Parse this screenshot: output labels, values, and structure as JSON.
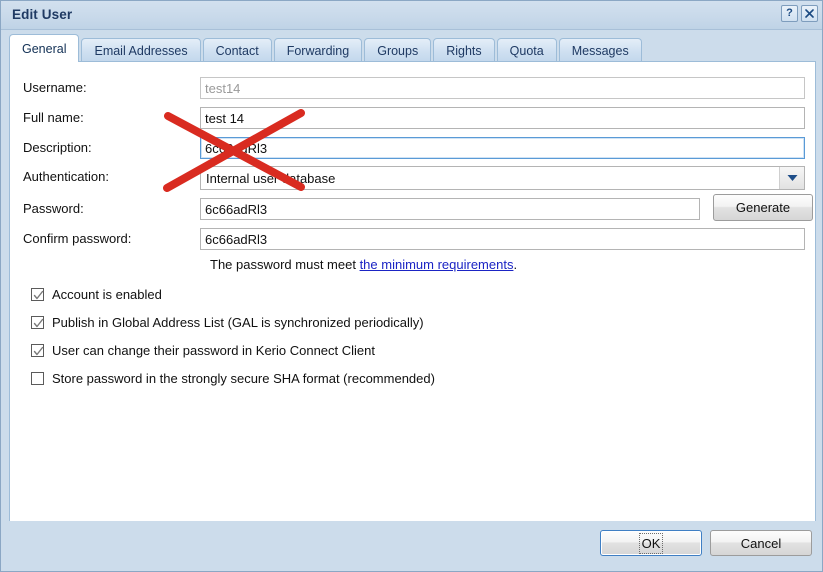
{
  "window": {
    "title": "Edit User",
    "help_button": "?",
    "close_button": "✕"
  },
  "tabs": [
    {
      "label": "General",
      "active": true
    },
    {
      "label": "Email Addresses",
      "active": false
    },
    {
      "label": "Contact",
      "active": false
    },
    {
      "label": "Forwarding",
      "active": false
    },
    {
      "label": "Groups",
      "active": false
    },
    {
      "label": "Rights",
      "active": false
    },
    {
      "label": "Quota",
      "active": false
    },
    {
      "label": "Messages",
      "active": false
    }
  ],
  "form": {
    "username": {
      "label": "Username:",
      "value": "test14",
      "disabled": true
    },
    "fullname": {
      "label": "Full name:",
      "value": "test 14"
    },
    "description": {
      "label": "Description:",
      "value": "6c66adRl3",
      "focused": true
    },
    "authentication": {
      "label": "Authentication:",
      "value": "Internal user database"
    },
    "password": {
      "label": "Password:",
      "value": "6c66adRl3"
    },
    "confirm_password": {
      "label": "Confirm password:",
      "value": "6c66adRl3"
    },
    "generate_button": "Generate"
  },
  "hint": {
    "prefix": "The password must meet ",
    "link": "the minimum requirements",
    "suffix": "."
  },
  "checkboxes": [
    {
      "label": "Account is enabled",
      "checked": true
    },
    {
      "label": "Publish in Global Address List (GAL is synchronized periodically)",
      "checked": true
    },
    {
      "label": "User can change their password in Kerio Connect Client",
      "checked": true
    },
    {
      "label": "Store password in the strongly secure SHA format (recommended)",
      "checked": false
    }
  ],
  "footer": {
    "ok": "OK",
    "cancel": "Cancel"
  },
  "annotation": {
    "type": "red-x-strikeout",
    "color": "#d92b20"
  },
  "colors": {
    "titlebar_text": "#1f3a63",
    "chrome": "#ccdceb",
    "panel": "#ffffff",
    "link": "#1b24c4",
    "focus_border": "#5a9ad6",
    "annotation_red": "#d92b20"
  }
}
